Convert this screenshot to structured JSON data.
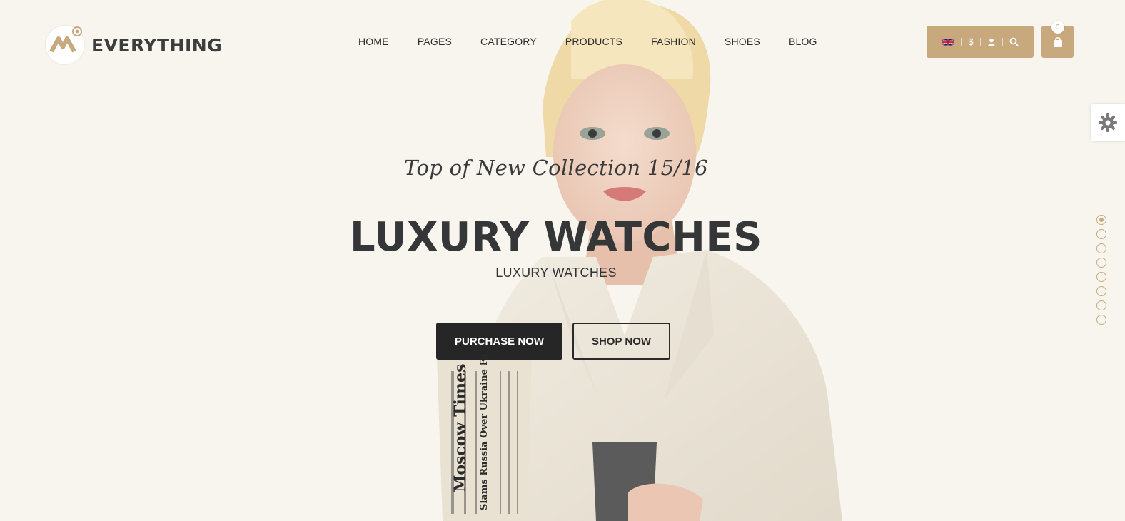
{
  "brand": {
    "name": "EVERYTHING",
    "accent_color": "#c8a97e",
    "logo_icon": "m-logo-icon"
  },
  "nav": {
    "items": [
      {
        "label": "HOME"
      },
      {
        "label": "PAGES"
      },
      {
        "label": "CATEGORY"
      },
      {
        "label": "PRODUCTS"
      },
      {
        "label": "FASHION"
      },
      {
        "label": "SHOES"
      },
      {
        "label": "BLOG"
      }
    ]
  },
  "utility": {
    "language_icon": "uk-flag-icon",
    "currency_symbol": "$",
    "account_icon": "user-icon",
    "search_icon": "search-icon"
  },
  "cart": {
    "count": "0",
    "icon": "shopping-bag-icon"
  },
  "settings": {
    "icon": "gear-icon"
  },
  "hero": {
    "subtitle": "Top of New Collection 15/16",
    "title": "LUXURY WATCHES",
    "caption": "LUXURY WATCHES",
    "primary_button": "PURCHASE NOW",
    "secondary_button": "SHOP NOW",
    "newspaper_text": "Moscow Times",
    "newspaper_headline": "Slams Russia Over Ukraine Fa"
  },
  "slider": {
    "total_slides": 8,
    "active_slide": 1
  }
}
